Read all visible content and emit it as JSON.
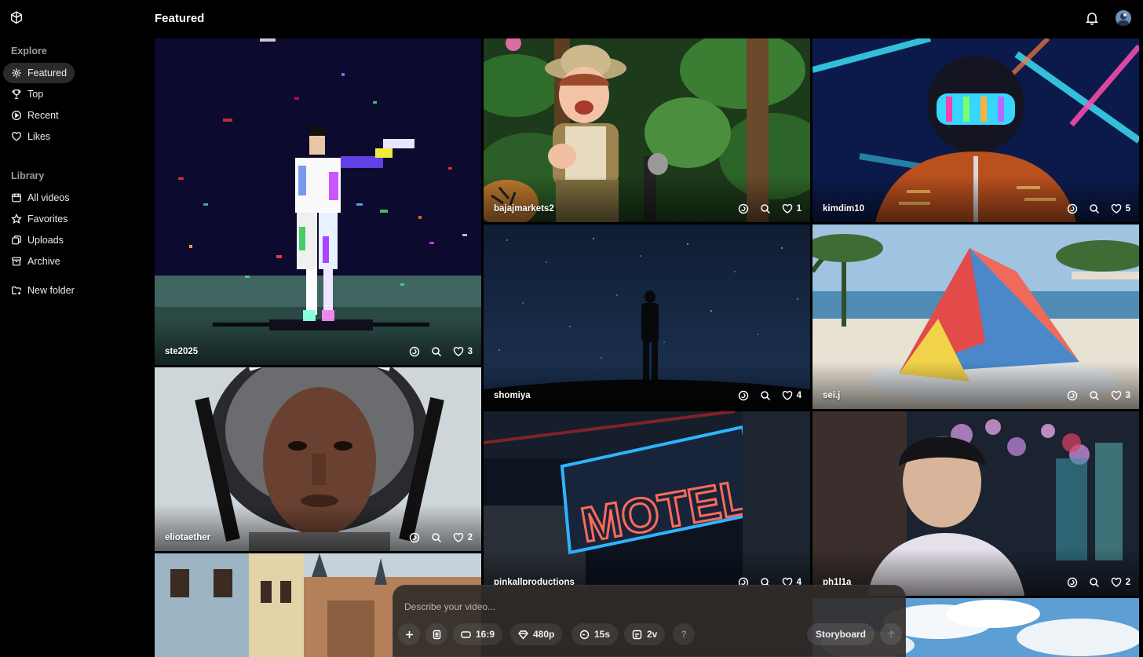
{
  "header": {
    "title": "Featured"
  },
  "sidebar": {
    "explore_title": "Explore",
    "library_title": "Library",
    "explore_items": [
      {
        "label": "Featured",
        "icon": "featured-icon",
        "active": true
      },
      {
        "label": "Top",
        "icon": "trophy-icon"
      },
      {
        "label": "Recent",
        "icon": "play-circle-icon"
      },
      {
        "label": "Likes",
        "icon": "heart-icon"
      }
    ],
    "library_items": [
      {
        "label": "All videos",
        "icon": "video-grid-icon"
      },
      {
        "label": "Favorites",
        "icon": "star-icon"
      },
      {
        "label": "Uploads",
        "icon": "uploads-icon"
      },
      {
        "label": "Archive",
        "icon": "archive-icon"
      }
    ],
    "new_folder": {
      "label": "New folder",
      "icon": "new-folder-icon"
    }
  },
  "tiles": [
    {
      "user": "ste2025",
      "likes": "3",
      "theme": "pixel-dancer"
    },
    {
      "user": "bajajmarkets2",
      "likes": "1",
      "theme": "jungle-explorer"
    },
    {
      "user": "kimdim10",
      "likes": "5",
      "theme": "neon-helmet"
    },
    {
      "user": "shomiya",
      "likes": "4",
      "theme": "night-sky"
    },
    {
      "user": "sei.j",
      "likes": "3",
      "theme": "shaved-ice"
    },
    {
      "user": "eliotaether",
      "likes": "2",
      "theme": "astronaut-portrait"
    },
    {
      "user": "pinkallproductions",
      "likes": "4",
      "theme": "motel-sign"
    },
    {
      "user": "ph1l1a",
      "likes": "2",
      "theme": "city-night-portrait"
    },
    {
      "user": "",
      "likes": "",
      "theme": "old-town-street"
    },
    {
      "user": "",
      "likes": "",
      "theme": "cloud-sky"
    }
  ],
  "art_text": {
    "motel": "MOTEL"
  },
  "composer": {
    "placeholder": "Describe your video...",
    "aspect": "16:9",
    "resolution": "480p",
    "duration": "15s",
    "variations": "2v",
    "help": "?",
    "storyboard": "Storyboard"
  },
  "colors": {
    "background": "#000000",
    "active_nav": "#2a2a2a",
    "composer_bg": "#302c2a"
  }
}
